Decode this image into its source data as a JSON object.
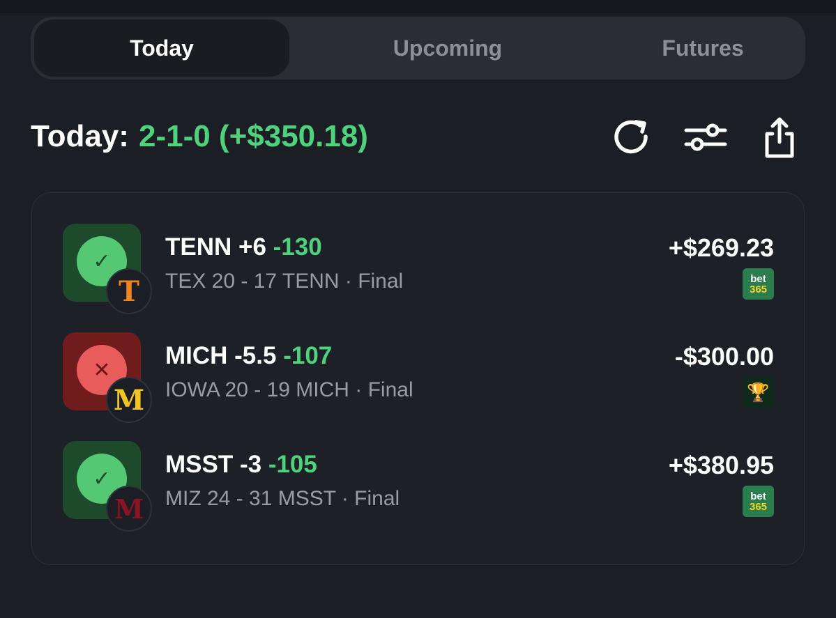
{
  "tabs": [
    {
      "label": "Today",
      "active": true
    },
    {
      "label": "Upcoming",
      "active": false
    },
    {
      "label": "Futures",
      "active": false
    }
  ],
  "summary": {
    "label": "Today:",
    "record": "2-1-0 (+$350.18)"
  },
  "toolbar": {
    "refresh_icon": "refresh-icon",
    "filter_icon": "sliders-icon",
    "share_icon": "share-icon"
  },
  "bets": [
    {
      "result": "win",
      "result_glyph": "✓",
      "team_logo": "T",
      "pick": "TENN +6",
      "odds": "-130",
      "score": "TEX 20 - 17 TENN · Final",
      "amount": "+$269.23",
      "book": {
        "line1": "bet",
        "line2": "365"
      }
    },
    {
      "result": "loss",
      "result_glyph": "✕",
      "team_logo": "M",
      "pick": "MICH -5.5",
      "odds": "-107",
      "score": "IOWA 20 - 19 MICH · Final",
      "amount": "-$300.00",
      "book": {
        "glyph": "🏆"
      }
    },
    {
      "result": "win",
      "result_glyph": "✓",
      "team_logo": "M",
      "pick": "MSST -3",
      "odds": "-105",
      "score": "MIZ 24 - 31 MSST · Final",
      "amount": "+$380.95",
      "book": {
        "line1": "bet",
        "line2": "365"
      }
    }
  ],
  "colors": {
    "background": "#1c1e25",
    "accent_green": "#4fd27c",
    "win_tile": "#1e4a2c",
    "loss_tile": "#701c1c"
  }
}
